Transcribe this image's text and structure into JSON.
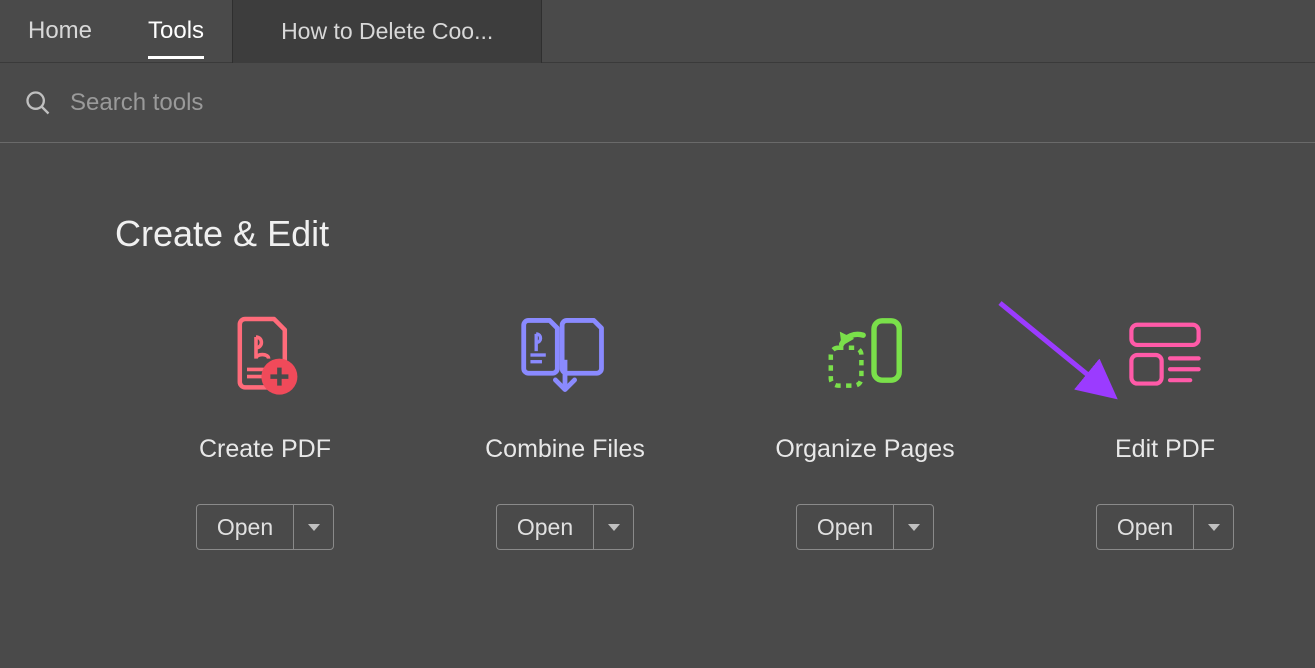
{
  "tabs": {
    "home": "Home",
    "tools": "Tools",
    "doc": "How to Delete Coo..."
  },
  "search": {
    "placeholder": "Search tools"
  },
  "section": {
    "title": "Create & Edit"
  },
  "tools": [
    {
      "name": "Create PDF",
      "open": "Open"
    },
    {
      "name": "Combine Files",
      "open": "Open"
    },
    {
      "name": "Organize Pages",
      "open": "Open"
    },
    {
      "name": "Edit PDF",
      "open": "Open"
    }
  ]
}
